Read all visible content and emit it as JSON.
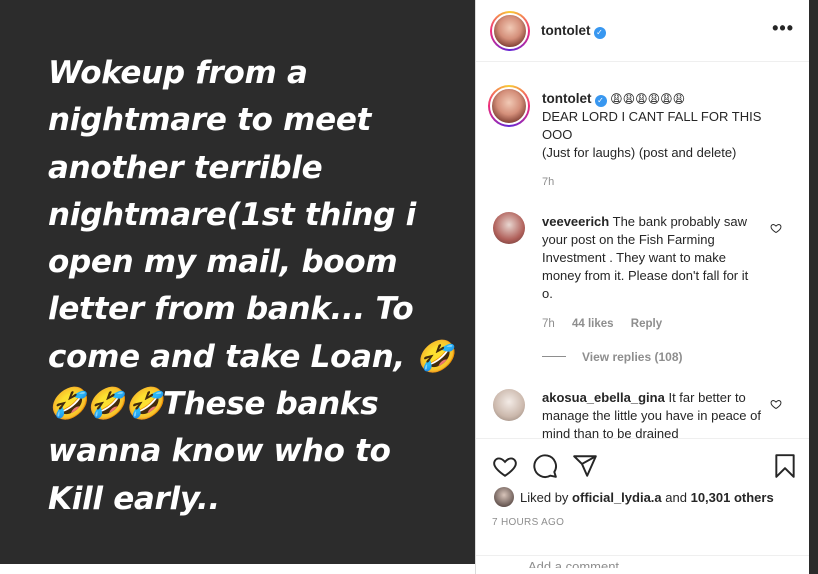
{
  "post": {
    "text": "Wokeup from a\nnightmare to meet\nanother terrible\nnightmare(1st thing i\nopen my mail, boom\nletter from bank... To\ncome and take Loan, 🤣\n🤣🤣🤣These banks\nwanna know who to\nKill early.."
  },
  "header": {
    "username": "tontolet",
    "more_label": "•••"
  },
  "caption": {
    "username": "tontolet",
    "emojis": "😩😩😩😩😩😩",
    "line1": "DEAR LORD I CANT FALL FOR THIS OOO",
    "line2": "(Just for laughs) (post and delete)",
    "time": "7h"
  },
  "comments": [
    {
      "username": "veeveerich",
      "text": "The bank probably saw your post on the Fish Farming Investment . They want to make money from it. Please don't fall for it o.",
      "time": "7h",
      "likes": "44 likes",
      "reply": "Reply",
      "view_replies": "View replies (108)"
    },
    {
      "username": "akosua_ebella_gina",
      "text": "It far better to manage the little you have in peace of mind than to be drained"
    }
  ],
  "actions": {
    "liked_prefix": "Liked by",
    "liked_user": "official_lydia.a",
    "liked_and": "and",
    "liked_count": "10,301 others",
    "posted_ago": "7 HOURS AGO",
    "add_comment_placeholder": "Add a comment..."
  },
  "icons": {
    "verified": "verified-badge-icon",
    "heart": "heart-icon",
    "comment": "comment-icon",
    "share": "share-icon",
    "save": "bookmark-icon"
  },
  "colors": {
    "left_bg": "#2c2c2c",
    "verified": "#3897f0",
    "meta_gray": "#8e8e8e"
  }
}
